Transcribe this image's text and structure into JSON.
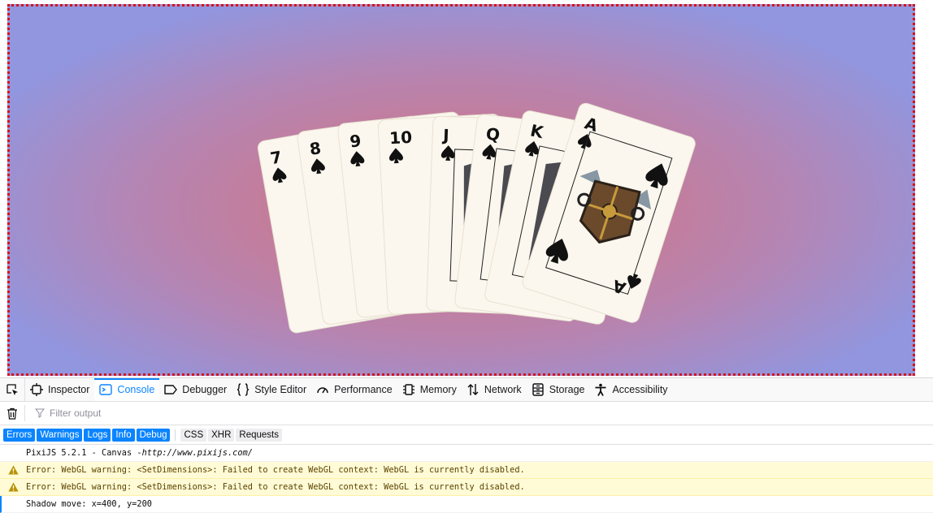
{
  "canvas": {
    "border_color": "#d8101a",
    "gradient_center": "#cf7586",
    "gradient_edge": "#9196df",
    "cards": [
      {
        "rank": "7",
        "suit": "spade",
        "kind": "number"
      },
      {
        "rank": "8",
        "suit": "spade",
        "kind": "number"
      },
      {
        "rank": "9",
        "suit": "spade",
        "kind": "number"
      },
      {
        "rank": "10",
        "suit": "spade",
        "kind": "number"
      },
      {
        "rank": "J",
        "suit": "spade",
        "kind": "face"
      },
      {
        "rank": "Q",
        "suit": "spade",
        "kind": "face"
      },
      {
        "rank": "K",
        "suit": "spade",
        "kind": "face"
      },
      {
        "rank": "A",
        "suit": "spade",
        "kind": "ace"
      }
    ]
  },
  "devtools": {
    "tabs": [
      {
        "label": "Inspector",
        "icon": "inspector-icon"
      },
      {
        "label": "Console",
        "icon": "console-icon",
        "selected": true
      },
      {
        "label": "Debugger",
        "icon": "debugger-icon"
      },
      {
        "label": "Style Editor",
        "icon": "style-editor-icon"
      },
      {
        "label": "Performance",
        "icon": "performance-icon"
      },
      {
        "label": "Memory",
        "icon": "memory-icon"
      },
      {
        "label": "Network",
        "icon": "network-icon"
      },
      {
        "label": "Storage",
        "icon": "storage-icon"
      },
      {
        "label": "Accessibility",
        "icon": "accessibility-icon"
      }
    ],
    "filter_placeholder": "Filter output",
    "level_filters": [
      {
        "label": "Errors",
        "on": true
      },
      {
        "label": "Warnings",
        "on": true
      },
      {
        "label": "Logs",
        "on": true
      },
      {
        "label": "Info",
        "on": true
      },
      {
        "label": "Debug",
        "on": true
      }
    ],
    "type_filters": [
      "CSS",
      "XHR",
      "Requests"
    ],
    "messages": [
      {
        "level": "log",
        "text": "PixiJS 5.2.1 - Canvas - ",
        "url": "http://www.pixijs.com/",
        "suffix": ""
      },
      {
        "level": "warning",
        "text": "Error: WebGL warning: <SetDimensions>: Failed to create WebGL context: WebGL is currently disabled."
      },
      {
        "level": "warning",
        "text": "Error: WebGL warning: <SetDimensions>: Failed to create WebGL context: WebGL is currently disabled."
      },
      {
        "level": "log",
        "text": "Shadow move: x=400, y=200"
      }
    ]
  }
}
